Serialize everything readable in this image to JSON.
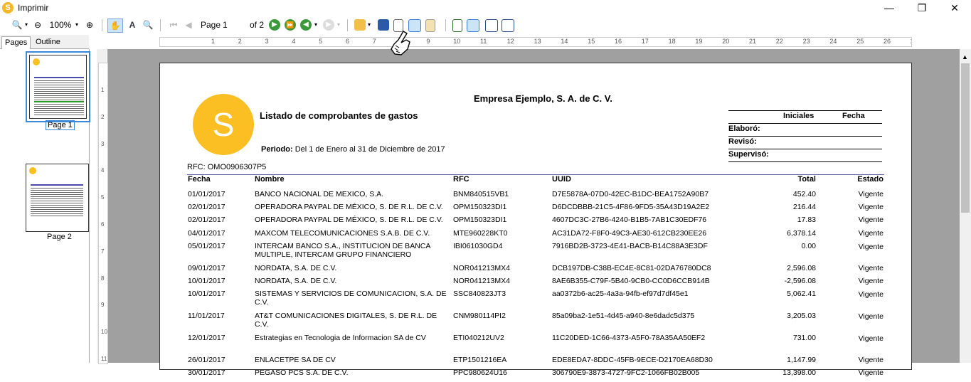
{
  "window": {
    "title": "Imprimir",
    "app_icon": "S"
  },
  "toolbar": {
    "zoom": "100%",
    "page_label": "Page",
    "page_value": "1",
    "of_label": "of 2"
  },
  "tabs": [
    "Pages",
    "Outline"
  ],
  "thumbnails": [
    {
      "label": "Page 1"
    },
    {
      "label": "Page 2"
    }
  ],
  "ruler": [
    "1",
    "2",
    "3",
    "4",
    "5",
    "6",
    "7",
    "8",
    "9",
    "10",
    "11",
    "12",
    "13",
    "14",
    "15",
    "16",
    "17",
    "18",
    "19",
    "20",
    "21",
    "22",
    "23",
    "24",
    "25",
    "26",
    "27"
  ],
  "vruler": [
    "1",
    "2",
    "3",
    "4",
    "5",
    "6",
    "7",
    "8",
    "9",
    "10",
    "11"
  ],
  "report": {
    "company": "Empresa Ejemplo, S. A. de C. V.",
    "title": "Listado de comprobantes de gastos",
    "period_label": "Periodo:",
    "period_value": "Del 1 de Enero al 31 de Diciembre de 2017",
    "logo_letter": "S",
    "rfc": "RFC: OMO0906307P5",
    "sig_header_initials": "Iniciales",
    "sig_header_date": "Fecha",
    "sig_rows": [
      "Elaboró:",
      "Revisó:",
      "Supervisó:"
    ],
    "columns": [
      "Fecha",
      "Nombre",
      "RFC",
      "UUID",
      "Total",
      "Estado"
    ],
    "rows": [
      {
        "fecha": "01/01/2017",
        "nombre": "BANCO NACIONAL DE MEXICO, S.A.",
        "rfc": "BNM840515VB1",
        "uuid": "D7E5878A-07D0-42EC-B1DC-BEA1752A90B7",
        "total": "452.40",
        "estado": "Vigente"
      },
      {
        "fecha": "02/01/2017",
        "nombre": "OPERADORA PAYPAL DE MÉXICO, S. DE R.L. DE C.V.",
        "rfc": "OPM150323DI1",
        "uuid": "D6DCDBBB-21C5-4F86-9FD5-35A43D19A2E2",
        "total": "216.44",
        "estado": "Vigente"
      },
      {
        "fecha": "02/01/2017",
        "nombre": "OPERADORA PAYPAL DE MÉXICO, S. DE R.L. DE C.V.",
        "rfc": "OPM150323DI1",
        "uuid": "4607DC3C-27B6-4240-B1B5-7AB1C30EDF76",
        "total": "17.83",
        "estado": "Vigente"
      },
      {
        "fecha": "04/01/2017",
        "nombre": "MAXCOM TELECOMUNICACIONES S.A.B. DE C.V.",
        "rfc": "MTE960228KT0",
        "uuid": "AC31DA72-F8F0-49C3-AE30-612CB230EE26",
        "total": "6,378.14",
        "estado": "Vigente"
      },
      {
        "fecha": "05/01/2017",
        "nombre": "INTERCAM BANCO S.A., INSTITUCION DE BANCA MULTIPLE, INTERCAM GRUPO FINANCIERO",
        "rfc": "IBI061030GD4",
        "uuid": "7916BD2B-3723-4E41-BACB-B14C88A3E3DF",
        "total": "0.00",
        "estado": "Vigente"
      },
      {
        "fecha": "09/01/2017",
        "nombre": "NORDATA, S.A. DE C.V.",
        "rfc": "NOR041213MX4",
        "uuid": "DCB197DB-C38B-EC4E-8C81-02DA76780DC8",
        "total": "2,596.08",
        "estado": "Vigente"
      },
      {
        "fecha": "10/01/2017",
        "nombre": "NORDATA, S.A. DE C.V.",
        "rfc": "NOR041213MX4",
        "uuid": "8AE6B355-C79F-5B40-9CB0-CC0D6CCB914B",
        "total": "-2,596.08",
        "estado": "Vigente"
      },
      {
        "fecha": "10/01/2017",
        "nombre": "SISTEMAS Y SERVICIOS DE COMUNICACION, S.A. DE C.V.",
        "rfc": "SSC840823JT3",
        "uuid": "aa0372b6-ac25-4a3a-94fb-ef97d7df45e1",
        "total": "5,062.41",
        "estado": "Vigente"
      },
      {
        "fecha": "11/01/2017",
        "nombre": "AT&T COMUNICACIONES DIGITALES, S. DE R.L. DE C.V.",
        "rfc": "CNM980114PI2",
        "uuid": "85a09ba2-1e51-4d45-a940-8e6dadc5d375",
        "total": "3,205.03",
        "estado": "Vigente"
      },
      {
        "fecha": "12/01/2017",
        "nombre": "Estrategias en Tecnologia de Informacion SA de CV",
        "rfc": "ETI040212UV2",
        "uuid": "11C20DED-1C66-4373-A5F0-78A35AA50EF2",
        "total": "731.00",
        "estado": "Vigente"
      },
      {
        "fecha": "26/01/2017",
        "nombre": "ENLACETPE SA DE CV",
        "rfc": "ETP1501216EA",
        "uuid": "EDE8EDA7-8DDC-45FB-9ECE-D2170EA68D30",
        "total": "1,147.99",
        "estado": "Vigente"
      },
      {
        "fecha": "30/01/2017",
        "nombre": "PEGASO PCS S.A. DE C.V.",
        "rfc": "PPC980624U16",
        "uuid": "306790E9-3873-4727-9FC2-1066FB02B005",
        "total": "13,398.00",
        "estado": "Vigente"
      }
    ]
  }
}
